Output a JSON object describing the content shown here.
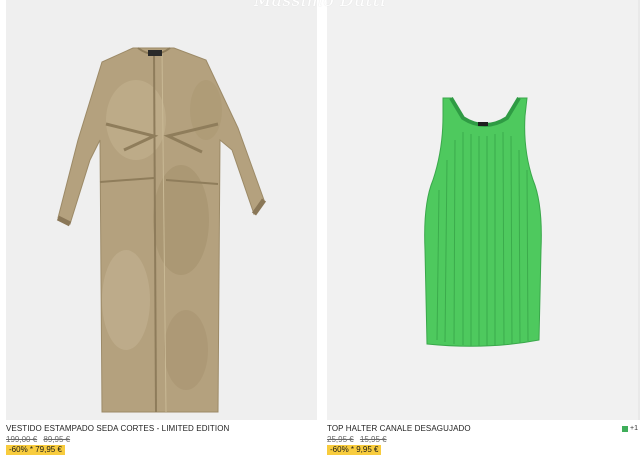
{
  "header": {
    "logo_text": "Massimo Dutti"
  },
  "products": [
    {
      "name": "VESTIDO ESTAMPADO SEDA CORTES - LIMITED EDITION",
      "original_price": "199,00 €",
      "previous_price": "89,95 €",
      "discount_label": "-60% * 79,95 €",
      "image_icon": "dress-icon",
      "image_color": "#b4a17e"
    },
    {
      "name": "TOP HALTER CANALE DESAGUJADO",
      "original_price": "25,95 €",
      "previous_price": "15,95 €",
      "discount_label": "-60% * 9,95 €",
      "image_icon": "halter-top-icon",
      "image_color": "#4ec95e",
      "swatch_color": "#3fae5a",
      "more_colors": "+1"
    }
  ],
  "colors": {
    "badge": "#f8cc3e",
    "photo_background": "#f0f0f0"
  }
}
